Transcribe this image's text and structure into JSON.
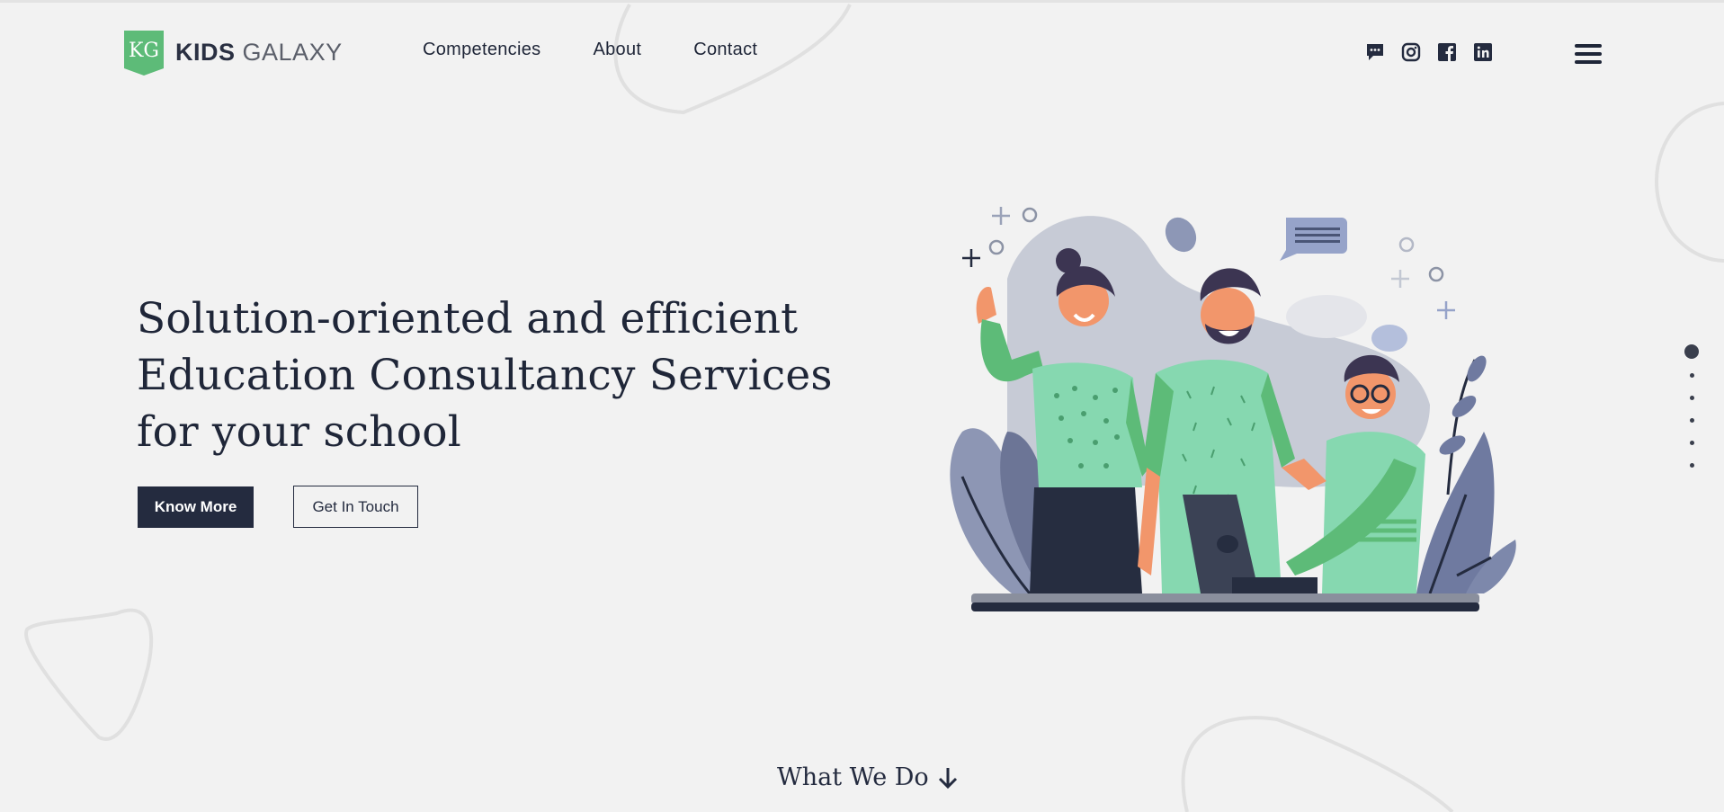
{
  "brand": {
    "badge": "KG",
    "name_bold": "KIDS",
    "name_light": "GALAXY",
    "accent_color": "#5dbb78"
  },
  "nav": {
    "items": [
      {
        "label": "Competencies"
      },
      {
        "label": "About"
      },
      {
        "label": "Contact"
      }
    ]
  },
  "social": {
    "icons": [
      "chat-icon",
      "instagram-icon",
      "facebook-icon",
      "linkedin-icon"
    ]
  },
  "menu_icon": "hamburger-menu-icon",
  "hero": {
    "headline_lines": [
      "Solution-oriented and efficient",
      "Education Consultancy Services",
      "for your school"
    ],
    "primary_button": "Know More",
    "secondary_button": "Get In Touch"
  },
  "slide_pagination": {
    "count": 6,
    "active_index": 0
  },
  "footer_cue": {
    "label": "What We Do",
    "icon": "arrow-down-icon"
  },
  "colors": {
    "background": "#f2f2f2",
    "dark": "#242b3f",
    "green": "#5dbb78",
    "mint": "#86d8b0",
    "slate": "#7a86a8"
  }
}
